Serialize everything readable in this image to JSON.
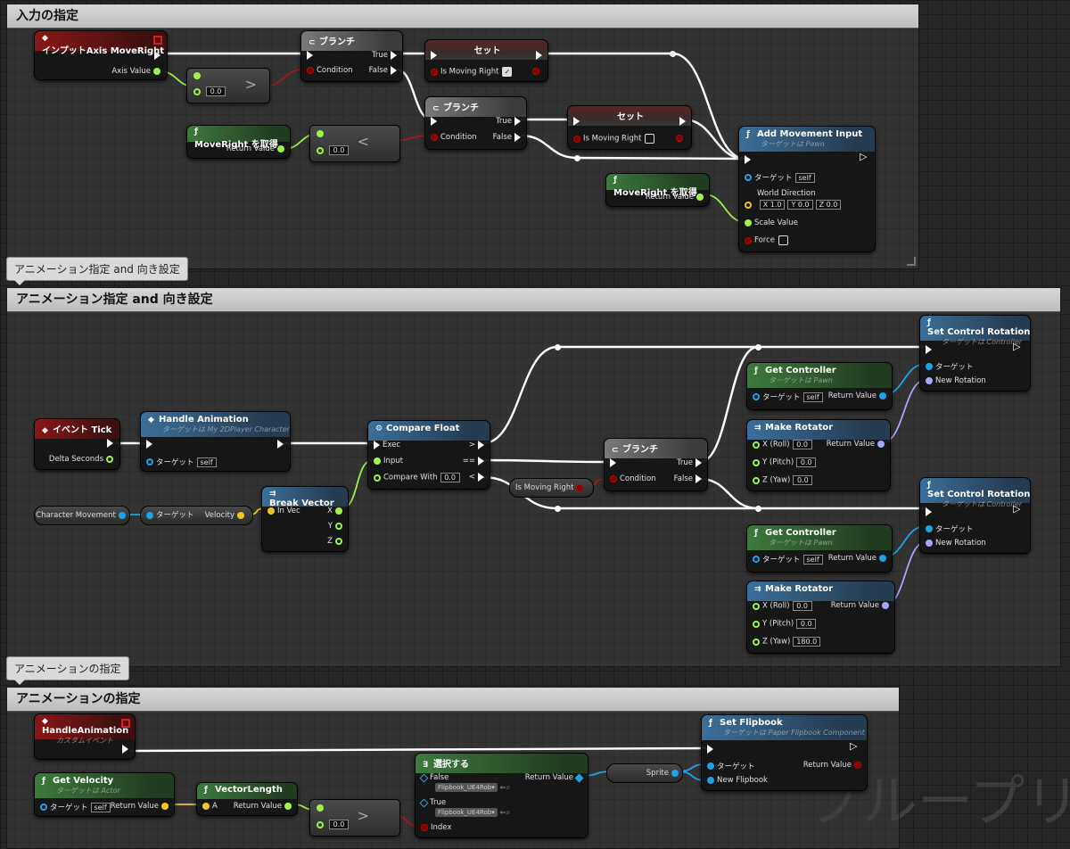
{
  "comments": {
    "input": "入力の指定",
    "anim_dir": "アニメーション指定 and 向き設定",
    "anim": "アニメーションの指定"
  },
  "bubbles": {
    "anim_dir": "アニメーション指定 and 向き設定",
    "anim": "アニメーションの指定"
  },
  "input": {
    "axis_event": {
      "title": "インプットAxis MoveRight",
      "axis_value": "Axis Value"
    },
    "greater1": {
      "b": "0.0"
    },
    "branch1": {
      "title": "ブランチ",
      "true": "True",
      "false": "False",
      "condition": "Condition"
    },
    "set1": {
      "title": "セット",
      "var": "Is Moving Right"
    },
    "branch2": {
      "title": "ブランチ",
      "true": "True",
      "false": "False",
      "condition": "Condition"
    },
    "set2": {
      "title": "セット",
      "var": "Is Moving Right"
    },
    "get1": {
      "title": "MoveRight を取得",
      "ret": "Return Value"
    },
    "less1": {
      "b": "0.0"
    },
    "get2": {
      "title": "MoveRight を取得",
      "ret": "Return Value"
    },
    "add_move": {
      "title": "Add Movement Input",
      "sub": "ターゲットは Pawn",
      "target": "ターゲット",
      "self": "self",
      "world_dir": "World Direction",
      "x": "1.0",
      "y": "0.0",
      "z": "0.0",
      "scale": "Scale Value",
      "force": "Force"
    }
  },
  "anim_dir": {
    "event_tick": {
      "title": "イベント Tick",
      "delta": "Delta Seconds"
    },
    "handle_anim": {
      "title": "Handle Animation",
      "sub": "ターゲットは My 2DPlayer Character",
      "target": "ターゲット",
      "self": "self"
    },
    "compare": {
      "title": "Compare Float",
      "exec": "Exec",
      "input": "Input",
      "compare_with": "Compare With",
      "cw_val": "0.0",
      "gt": ">",
      "eq": "==",
      "lt": "<"
    },
    "char_movement": "Character Movement",
    "velocity_node": {
      "target": "ターゲット",
      "velocity": "Velocity"
    },
    "break_vec": {
      "title": "Break Vector",
      "in": "In Vec",
      "x": "X",
      "y": "Y",
      "z": "Z"
    },
    "is_moving": "Is Moving Right",
    "branch": {
      "title": "ブランチ",
      "true": "True",
      "false": "False",
      "condition": "Condition"
    },
    "set_rot1": {
      "title": "Set Control Rotation",
      "sub": "ターゲットは Controller",
      "target": "ターゲット",
      "new_rot": "New Rotation"
    },
    "get_ctrl1": {
      "title": "Get Controller",
      "sub": "ターゲットは Pawn",
      "target": "ターゲット",
      "self": "self",
      "ret": "Return Value"
    },
    "make_rot1": {
      "title": "Make Rotator",
      "x": "X (Roll)",
      "y": "Y (Pitch)",
      "z": "Z (Yaw)",
      "xv": "0.0",
      "yv": "0.0",
      "zv": "0.0",
      "ret": "Return Value"
    },
    "set_rot2": {
      "title": "Set Control Rotation",
      "sub": "ターゲットは Controller",
      "target": "ターゲット",
      "new_rot": "New Rotation"
    },
    "get_ctrl2": {
      "title": "Get Controller",
      "sub": "ターゲットは Pawn",
      "target": "ターゲット",
      "self": "self",
      "ret": "Return Value"
    },
    "make_rot2": {
      "title": "Make Rotator",
      "x": "X (Roll)",
      "y": "Y (Pitch)",
      "z": "Z (Yaw)",
      "xv": "0.0",
      "yv": "0.0",
      "zv": "180.0",
      "ret": "Return Value"
    }
  },
  "anim": {
    "custom_event": {
      "title": "HandleAnimation",
      "sub": "カスタムイベント"
    },
    "get_vel": {
      "title": "Get Velocity",
      "sub": "ターゲットは Actor",
      "target": "ターゲット",
      "self": "self",
      "ret": "Return Value"
    },
    "vec_len": {
      "title": "VectorLength",
      "a": "A",
      "ret": "Return Value"
    },
    "greater": {
      "b": "0.0"
    },
    "select": {
      "title": "選択する",
      "false": "False",
      "true": "True",
      "fb_false": "Flipbook_UE4Rob▾",
      "fb_true": "Flipbook_UE4Rob▾",
      "index": "Index",
      "ret": "Return Value"
    },
    "sprite": "Sprite",
    "set_flip": {
      "title": "Set Flipbook",
      "sub": "ターゲットは Paper Flipbook Component",
      "target": "ターゲット",
      "new_fb": "New Flipbook",
      "ret": "Return Value"
    }
  },
  "watermark": "ブループリ"
}
